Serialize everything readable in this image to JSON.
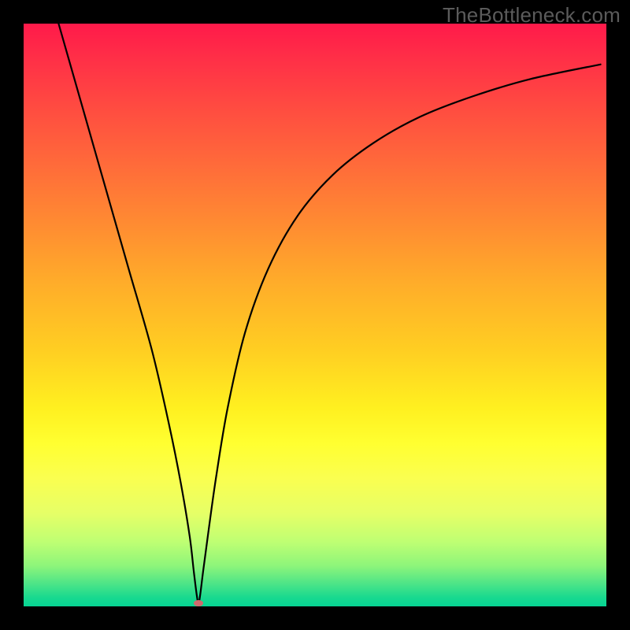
{
  "watermark": "TheBottleneck.com",
  "chart_data": {
    "type": "line",
    "title": "",
    "xlabel": "",
    "ylabel": "",
    "xlim": [
      0,
      100
    ],
    "ylim": [
      0,
      100
    ],
    "grid": false,
    "legend": false,
    "series": [
      {
        "name": "bottleneck-curve",
        "x": [
          6,
          10,
          14,
          18,
          22,
          25,
          27,
          28.5,
          29.2,
          29.7,
          30,
          30.3,
          30.8,
          31.6,
          33,
          35,
          38,
          42,
          47,
          53,
          60,
          68,
          77,
          87,
          99
        ],
        "y": [
          100,
          86,
          72,
          58,
          44,
          31,
          21,
          12,
          6,
          2,
          0.5,
          2,
          6,
          12,
          22,
          34,
          47,
          58,
          67,
          74,
          79.5,
          84,
          87.5,
          90.5,
          93
        ]
      }
    ],
    "annotations": [
      {
        "name": "minimum-marker",
        "x": 30,
        "y": 0.5,
        "color": "#cf6a6e"
      }
    ],
    "background_gradient": {
      "direction": "vertical",
      "stops": [
        {
          "pos": 0.0,
          "color": "#ff1a4a"
        },
        {
          "pos": 0.3,
          "color": "#ff7a36"
        },
        {
          "pos": 0.6,
          "color": "#ffe022"
        },
        {
          "pos": 0.8,
          "color": "#f0ff55"
        },
        {
          "pos": 0.95,
          "color": "#60e985"
        },
        {
          "pos": 1.0,
          "color": "#06d493"
        }
      ]
    }
  }
}
